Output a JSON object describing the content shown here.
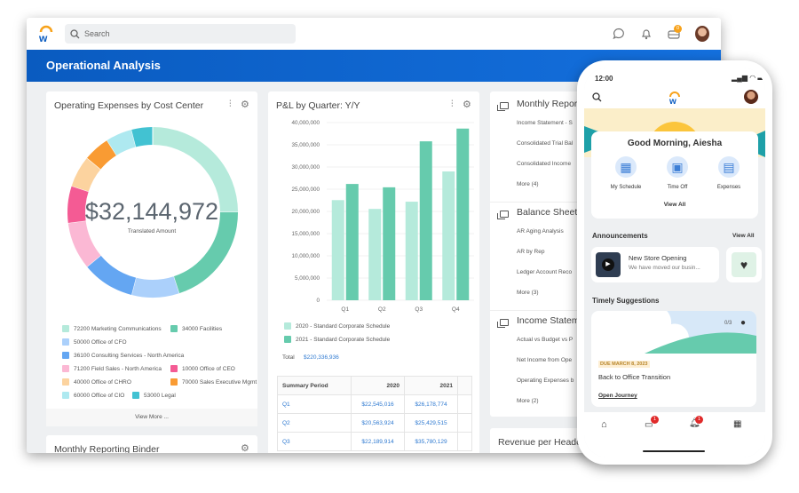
{
  "header": {
    "search_placeholder": "Search",
    "inbox_badge": "0",
    "page_title": "Operational Analysis"
  },
  "colors": {
    "brand_blue": "#0a5bc0",
    "accent_orange": "#f7a21b",
    "link": "#2f7ad1"
  },
  "expenses_card": {
    "title": "Operating Expenses by Cost Center",
    "total": "$32,144,972",
    "total_label": "Translated Amount",
    "view_more": "View More ...",
    "icons": [
      "filter-sliders-icon",
      "gear-icon"
    ]
  },
  "binder_card": {
    "title": "Monthly Reporting Binder"
  },
  "pl_card": {
    "title": "P&L by Quarter: Y/Y",
    "total_label": "Total",
    "total_value": "$220,336,936",
    "table": {
      "headers": [
        "Summary Period",
        "2020",
        "2021"
      ],
      "rows": [
        [
          "Q1",
          "$22,545,016",
          "$26,178,774"
        ],
        [
          "Q2",
          "$20,563,924",
          "$25,429,515"
        ],
        [
          "Q3",
          "$22,189,914",
          "$35,780,129"
        ]
      ]
    }
  },
  "chart_data": [
    {
      "type": "pie",
      "donut": true,
      "categories": [
        "72200 Marketing Communications",
        "34000 Facilities",
        "50000 Office of CFO",
        "36100 Consulting Services - North America",
        "71200 Field Sales - North America",
        "10000 Office of CEO",
        "40000 Office of CHRO",
        "70000 Sales Executive Mgmt",
        "60000 Office of CIO",
        "53000 Legal"
      ],
      "values": [
        25,
        20,
        9,
        10,
        9,
        7,
        6,
        5,
        5,
        4
      ],
      "colors": [
        "#b5eadb",
        "#66cbad",
        "#abd0fb",
        "#64a6f2",
        "#fbb8d4",
        "#f45b94",
        "#fcd39f",
        "#f99b33",
        "#aee9f0",
        "#42c2d2"
      ],
      "legend": "bottom"
    },
    {
      "type": "bar",
      "categories": [
        "Q1",
        "Q2",
        "Q3",
        "Q4"
      ],
      "series": [
        {
          "name": "2020 - Standard Corporate Schedule",
          "values": [
            22545016,
            20563924,
            22189914,
            29000000
          ],
          "color": "#b5eadb"
        },
        {
          "name": "2021 - Standard Corporate Schedule",
          "values": [
            26178774,
            25429515,
            35780129,
            38650000
          ],
          "color": "#66cbad"
        }
      ],
      "ylim": [
        0,
        40000000
      ],
      "yticks": [
        "0",
        "5,000,000",
        "10,000,000",
        "15,000,000",
        "20,000,000",
        "25,000,000",
        "30,000,000",
        "35,000,000",
        "40,000,000"
      ],
      "grid": true,
      "legend": "bottom"
    }
  ],
  "reports": [
    {
      "title": "Monthly Reporting",
      "items": [
        "Income Statement - S",
        "Consolidated Trial Bal",
        "Consolidated Income"
      ],
      "more": "More (4)"
    },
    {
      "title": "Balance Sheet R",
      "items": [
        "AR Aging Analysis",
        "AR by Rep",
        "Ledger Account Reco"
      ],
      "more": "More (3)"
    },
    {
      "title": "Income Stateme",
      "items": [
        "Actual vs Budget vs P",
        "Net Income from Ope",
        "Operating Expenses b"
      ],
      "more": "More (2)"
    }
  ],
  "revenue_card": {
    "title": "Revenue per Headco"
  },
  "phone": {
    "time": "12:00",
    "greeting": "Good Morning, Aiesha",
    "quick_actions": [
      {
        "label": "My Schedule",
        "icon": "calendar-icon"
      },
      {
        "label": "Time Off",
        "icon": "suitcase-icon"
      },
      {
        "label": "Expenses",
        "icon": "receipt-icon"
      }
    ],
    "view_all": "View All",
    "announcements_title": "Announcements",
    "announcements_view_all": "View All",
    "announcement": {
      "title": "New Store Opening",
      "body": "We have moved our busin..."
    },
    "suggestions_title": "Timely Suggestions",
    "suggestion": {
      "progress": "0/3",
      "due": "DUE MARCH 8, 2023",
      "title": "Back to Office Transition",
      "action": "Open Journey"
    },
    "nav": [
      {
        "icon": "home-icon"
      },
      {
        "icon": "inbox-icon",
        "badge": "1"
      },
      {
        "icon": "bell-icon",
        "badge": "1"
      },
      {
        "icon": "apps-grid-icon"
      }
    ]
  }
}
